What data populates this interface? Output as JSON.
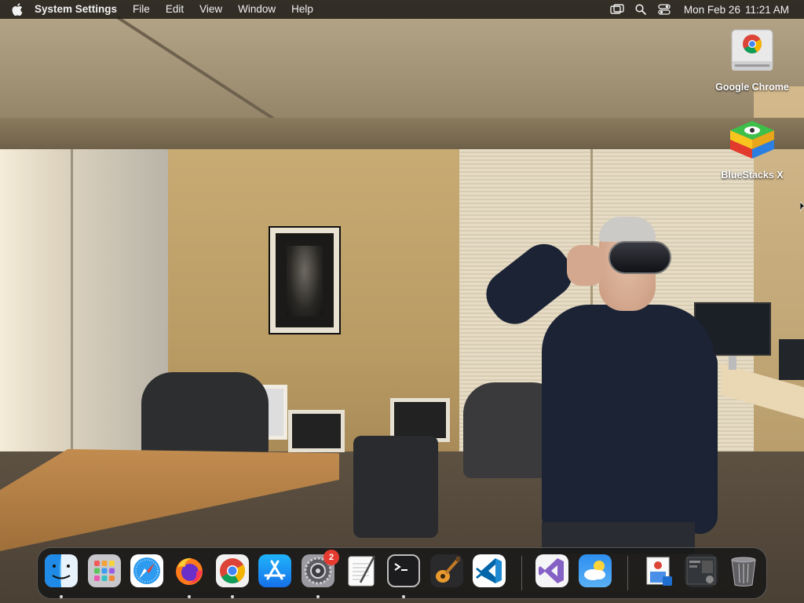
{
  "menubar": {
    "app_name": "System Settings",
    "menus": [
      "File",
      "Edit",
      "View",
      "Window",
      "Help"
    ],
    "clock": {
      "date": "Mon Feb 26",
      "time": "11:21 AM"
    },
    "tray_icons": [
      "screen-mirroring-icon",
      "spotlight-search-icon",
      "control-center-icon"
    ]
  },
  "desktop": {
    "icons": [
      {
        "label": "Google Chrome",
        "icon": "chrome-drive-icon"
      },
      {
        "label": "BlueStacks X",
        "icon": "bluestacks-icon"
      }
    ]
  },
  "dock": {
    "apps": [
      {
        "name": "Finder",
        "icon": "finder-icon",
        "running": true
      },
      {
        "name": "Launchpad",
        "icon": "launchpad-icon",
        "running": false
      },
      {
        "name": "Safari",
        "icon": "safari-icon",
        "running": false
      },
      {
        "name": "Firefox",
        "icon": "firefox-icon",
        "running": true
      },
      {
        "name": "Google Chrome",
        "icon": "chrome-icon",
        "running": true
      },
      {
        "name": "App Store",
        "icon": "app-store-icon",
        "running": false
      },
      {
        "name": "System Settings",
        "icon": "system-settings-icon",
        "running": true,
        "badge": "2"
      },
      {
        "name": "TextEdit",
        "icon": "textedit-icon",
        "running": false
      },
      {
        "name": "Terminal",
        "icon": "terminal-icon",
        "running": true
      },
      {
        "name": "GarageBand",
        "icon": "garageband-icon",
        "running": false
      },
      {
        "name": "Visual Studio Code",
        "icon": "vscode-icon",
        "running": false
      }
    ],
    "recent_apps": [
      {
        "name": "Visual Studio",
        "icon": "visual-studio-icon"
      },
      {
        "name": "Weather",
        "icon": "weather-icon"
      }
    ],
    "stacks": [
      {
        "name": "Downloads",
        "icon": "downloads-stack-icon"
      },
      {
        "name": "Screenshots",
        "icon": "screenshots-stack-icon"
      },
      {
        "name": "Trash",
        "icon": "trash-icon"
      }
    ]
  },
  "colors": {
    "menubar_bg": "#201c18",
    "dock_bg": "#161616",
    "badge_red": "#e53b30",
    "vscode_blue": "#1f8ad2",
    "vs_purple": "#8661c5"
  }
}
